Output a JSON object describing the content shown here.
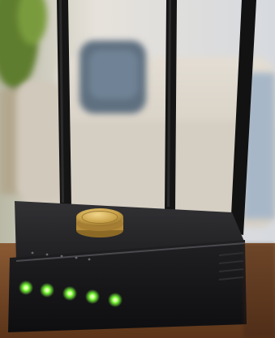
{
  "scene": {
    "subject": "wifi-router-with-three-antennas",
    "colors": {
      "router_body": "#1c1c1e",
      "router_top": "#2a2a2d",
      "antenna": "#151515",
      "status_led": "#7cff3a",
      "coin": "#c9a24a",
      "wood_surface": "#7a4a26",
      "sofa": "#d9d2c7",
      "pillow": "#5e6f80",
      "background_wall": "#e8e4de",
      "plant_green": "#5f7d2f"
    },
    "status_led_count": 5,
    "antenna_count": 3
  }
}
